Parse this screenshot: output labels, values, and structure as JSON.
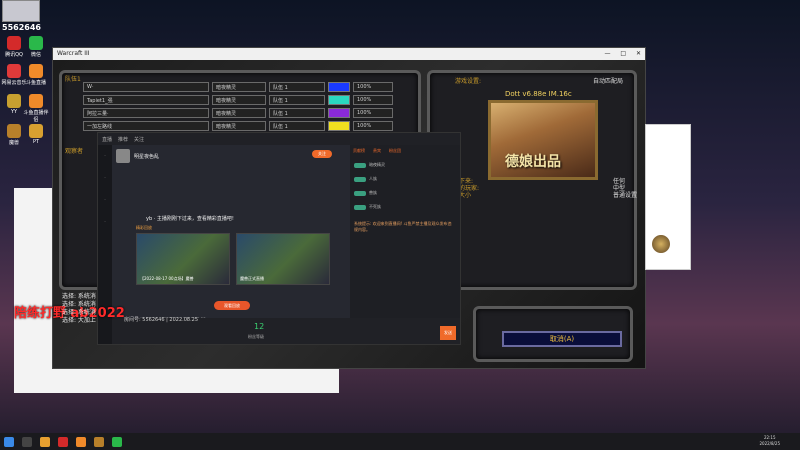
{
  "desktop": {
    "streamer_id": "5562646",
    "icons": [
      {
        "label": "腾讯QQ",
        "color": "#d42a2a"
      },
      {
        "label": "微信",
        "color": "#2ab84a"
      },
      {
        "label": "网易云音乐",
        "color": "#e03a3a"
      },
      {
        "label": "斗鱼直播",
        "color": "#f08a2a"
      },
      {
        "label": "YY",
        "color": "#c8a030"
      },
      {
        "label": "斗鱼直播伴侣",
        "color": "#f08a2a"
      },
      {
        "label": "魔兽",
        "color": "#b8802a"
      },
      {
        "label": "PT",
        "color": "#d8a030"
      }
    ]
  },
  "game_window": {
    "title": "Warcraft III",
    "controls": [
      "—",
      "□",
      "✕"
    ],
    "section_label": "队伍1",
    "section2_label": "观察者",
    "players": [
      {
        "name": "W·",
        "status": "暗夜精灵",
        "team": "队伍 1",
        "color": "#1a3aff",
        "handicap": "100%"
      },
      {
        "name": "Tapiet1_强",
        "status": "暗夜精灵",
        "team": "队伍 1",
        "color": "#2ad8c0",
        "handicap": "100%"
      },
      {
        "name": "阿拉三量·",
        "status": "暗夜精灵",
        "team": "队伍 1",
        "color": "#8a2ad8",
        "handicap": "100%"
      },
      {
        "name": "一加左路线",
        "status": "暗夜精灵",
        "team": "队伍 1",
        "color": "#f0e020",
        "handicap": "100%"
      }
    ],
    "map_label": "游戏设置:",
    "auto_match": "自动匹配局",
    "map_name": "Dott v6.88e IM.16c",
    "map_banner": "德娘出品",
    "left_side_text": [
      "接下来:",
      "近的玩家:",
      "的大小"
    ],
    "right_side_text": [
      "任何",
      "中型",
      "普通设置"
    ],
    "cancel_button": "取消(A)"
  },
  "stream_client": {
    "tabs": [
      "直播",
      "推荐",
      "关注"
    ],
    "streamer_name": "明星夜色乱",
    "follow_label": "关注",
    "notice": "yb · 主播刚刚下过来，查看精彩直播吧!",
    "replay_label": "精彩回放",
    "replays": [
      {
        "title": "【2022-08-17 00点场】魔兽"
      },
      {
        "title": "魔兽正式直播"
      }
    ],
    "watch_button": "观看回放",
    "room_info": "房间: 直播号: 5562646 | 2022.08.25",
    "level": "12",
    "level_label": "粉丝等级",
    "chat_tabs": [
      "贡献榜",
      "贵宾",
      "粉丝团"
    ],
    "chat_entries": [
      "暗夜精灵",
      "人族",
      "兽族",
      "不死族"
    ],
    "system_msg": "系统提示: 欢迎来到直播间! 斗鱼严禁主播及观众发布违规内容。",
    "send_label": "发送"
  },
  "overlay": {
    "red_text": "陪练打野 ab2022",
    "chat_lines": [
      "选择: 系统消",
      "选择: 系统消",
      "选择: 系统消",
      "选择: 大加上"
    ],
    "date_line": "房间号: 5562646 | 2022.08.25"
  },
  "taskbar": {
    "time": "22:15",
    "date": "2022/8/25"
  }
}
